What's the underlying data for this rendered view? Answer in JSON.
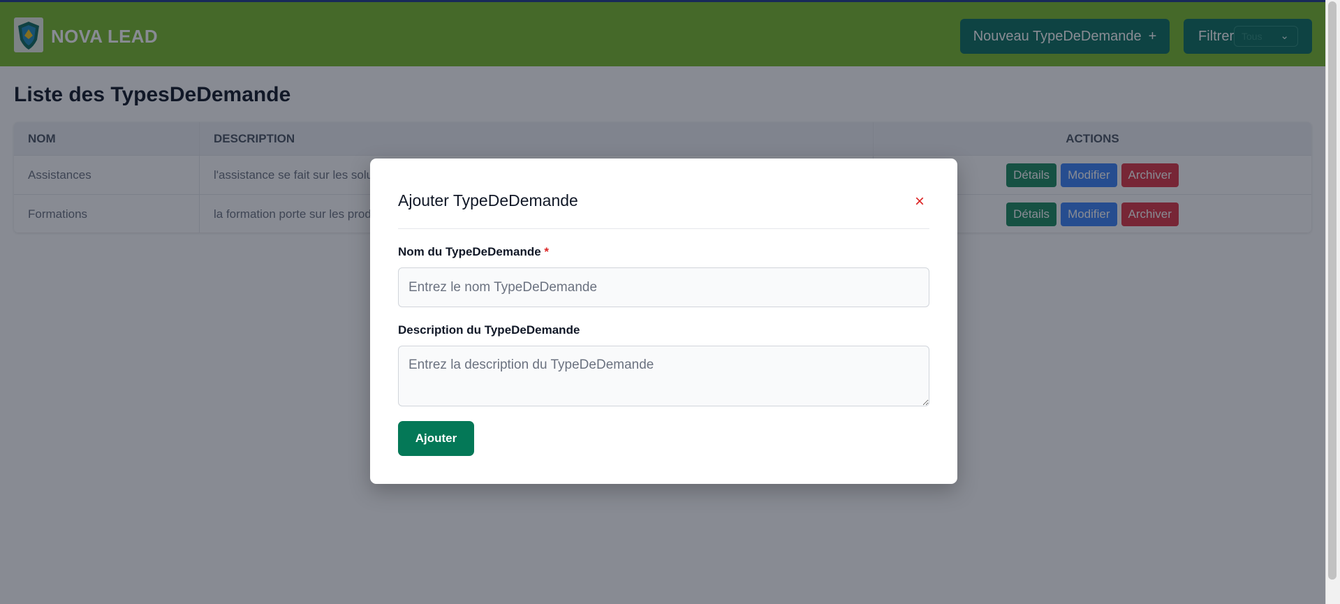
{
  "header": {
    "brand": "NOVA LEAD",
    "new_button_label": "Nouveau TypeDeDemande",
    "new_button_icon": "+",
    "filter_label": "Filtrer",
    "filter_value": "Tous",
    "filter_chevron": "⌄",
    "colors": {
      "bar": "#79ba2b",
      "button": "#0b6e5f"
    }
  },
  "page": {
    "title": "Liste des TypesDeDemande"
  },
  "table": {
    "columns": [
      "NOM",
      "DESCRIPTION",
      "ACTIONS"
    ],
    "rows": [
      {
        "nom": "Assistances",
        "description": "l'assistance se fait sur les solutions"
      },
      {
        "nom": "Formations",
        "description": "la formation porte sur les produits"
      }
    ],
    "actions": {
      "details": "Détails",
      "modifier": "Modifier",
      "archiver": "Archiver"
    }
  },
  "modal": {
    "title": "Ajouter TypeDeDemande",
    "close_icon": "×",
    "name_label": "Nom du TypeDeDemande",
    "required_mark": "*",
    "name_placeholder": "Entrez le nom TypeDeDemande",
    "name_value": "",
    "description_label": "Description du TypeDeDemande",
    "description_placeholder": "Entrez la description du TypeDeDemande",
    "description_value": "",
    "submit_label": "Ajouter"
  }
}
